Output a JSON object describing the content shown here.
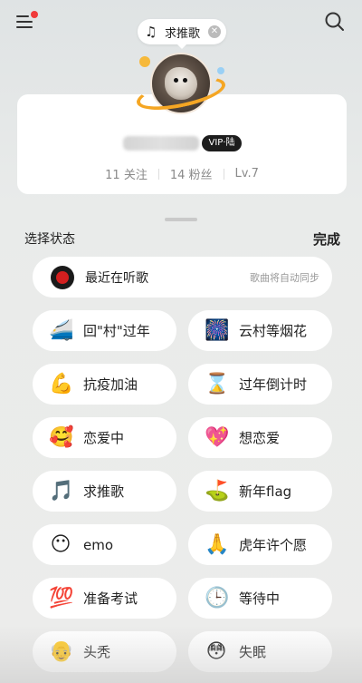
{
  "header": {
    "status_pill": {
      "icon": "music-note-icon",
      "label": "求推歌",
      "close_icon": "close-icon"
    }
  },
  "profile": {
    "vip_badge": "VIP·陆",
    "stats": {
      "follow": "11 关注",
      "fans": "14 粉丝",
      "level": "Lv.7"
    }
  },
  "panel": {
    "title": "选择状态",
    "done_label": "完成",
    "recent": {
      "label": "最近在听歌",
      "hint": "歌曲将自动同步",
      "icon": "vinyl-record-icon"
    },
    "statuses": [
      {
        "emoji": "🚄",
        "icon": "train-icon",
        "label": "回\"村\"过年"
      },
      {
        "emoji": "🎆",
        "icon": "fireworks-icon",
        "label": "云村等烟花"
      },
      {
        "emoji": "💪",
        "icon": "flexed-arm-icon",
        "label": "抗疫加油"
      },
      {
        "emoji": "⌛",
        "icon": "hourglass-icon",
        "label": "过年倒计时"
      },
      {
        "emoji": "🥰",
        "icon": "smiling-hearts-icon",
        "label": "恋爱中"
      },
      {
        "emoji": "💖",
        "icon": "heart-icon",
        "label": "想恋爱"
      },
      {
        "emoji": "🎵",
        "icon": "music-note-icon",
        "label": "求推歌"
      },
      {
        "emoji": "⛳",
        "icon": "golf-flag-icon",
        "label": "新年flag"
      },
      {
        "emoji": "😶",
        "icon": "blank-face-icon",
        "label": "emo"
      },
      {
        "emoji": "🙏",
        "icon": "praying-hands-icon",
        "label": "虎年许个愿"
      },
      {
        "emoji": "💯",
        "icon": "hundred-points-icon",
        "label": "准备考试"
      },
      {
        "emoji": "🕒",
        "icon": "clock-icon",
        "label": "等待中"
      },
      {
        "emoji": "👴",
        "icon": "bald-head-icon",
        "label": "头秃"
      },
      {
        "emoji": "😳",
        "icon": "flushed-face-icon",
        "label": "失眠"
      }
    ]
  }
}
